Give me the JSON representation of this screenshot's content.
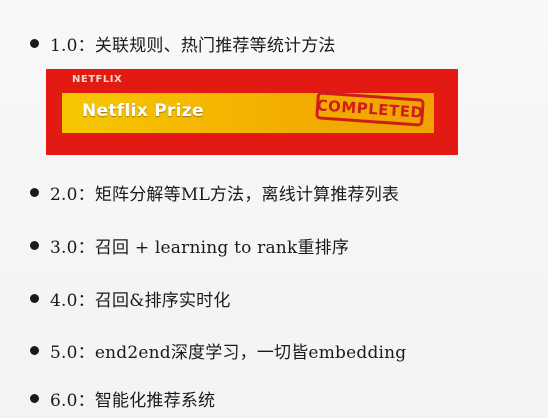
{
  "slide": {
    "bullets": [
      {
        "text": "1.0：关联规则、热门推荐等统计方法"
      },
      {
        "text": "2.0：矩阵分解等ML方法，离线计算推荐列表"
      },
      {
        "text": "3.0：召回 + learning to rank重排序"
      },
      {
        "text": "4.0：召回&排序实时化"
      },
      {
        "text": "5.0：end2end深度学习，一切皆embedding"
      },
      {
        "text": "6.0：智能化推荐系统"
      }
    ],
    "banner": {
      "brand": "NETFLIX",
      "title": "Netflix Prize",
      "stamp": "COMPLETED",
      "colors": {
        "background": "#e31a12",
        "strip": "#f6c700",
        "stamp": "#cf1d1d"
      }
    }
  }
}
